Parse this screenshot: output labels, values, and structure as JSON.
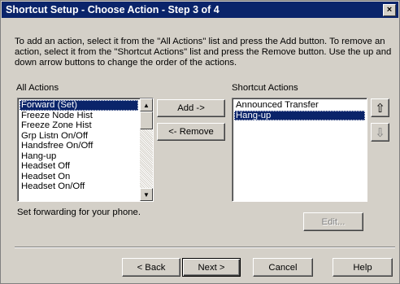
{
  "window": {
    "title": "Shortcut Setup - Choose Action - Step 3 of 4",
    "close_glyph": "×"
  },
  "instructions": "To add an action, select it from the \"All Actions\" list and press the Add button.  To remove an action, select it from the \"Shortcut Actions\" list and press the Remove button. Use the up and down arrow buttons to change the order of the actions.",
  "all_actions": {
    "label": "All Actions",
    "items": [
      "Forward (Set)",
      "Freeze Node Hist",
      "Freeze Zone Hist",
      "Grp Listn On/Off",
      "Handsfree On/Off",
      "Hang-up",
      "Headset Off",
      "Headset On",
      "Headset On/Off"
    ],
    "selected_index": 0
  },
  "shortcut_actions": {
    "label": "Shortcut Actions",
    "items": [
      "Announced Transfer",
      "Hang-up"
    ],
    "selected_index": 1
  },
  "buttons": {
    "add": "Add ->",
    "remove": "<- Remove",
    "edit": "Edit...",
    "back": "< Back",
    "next": "Next >",
    "cancel": "Cancel",
    "help": "Help",
    "move_up_icon": "up-arrow-icon",
    "move_down_icon": "down-arrow-icon"
  },
  "description": "Set forwarding for your phone.",
  "colors": {
    "selection": "#0a246a",
    "face": "#d4d0c8"
  }
}
